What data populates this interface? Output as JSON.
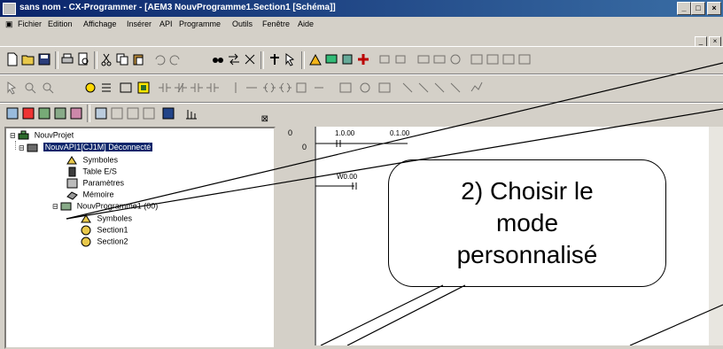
{
  "window": {
    "title": "sans nom - CX-Programmer - [AEM3 NouvProgramme1.Section1 [Schéma]]",
    "controls": [
      "_",
      "□",
      "×"
    ]
  },
  "menu": {
    "items": [
      "Fichier",
      "Edition",
      "Affichage",
      "Insérer",
      "API",
      "Programme",
      "Outils",
      "Fenêtre",
      "Aide"
    ],
    "mdi_controls": [
      "_",
      "×"
    ]
  },
  "tree": {
    "root": "NouvProjet",
    "plc": "NouvAPI1[CJ1M] Déconnecté",
    "children": [
      "Symboles",
      "Table E/S",
      "Paramètres",
      "Mémoire"
    ],
    "program": "NouvProgramme1 (00)",
    "program_children": [
      "Symboles",
      "Section1",
      "Section2"
    ]
  },
  "ladder": {
    "rung_number": "0",
    "step_number": "0",
    "contacts": [
      {
        "address": "1.0.00"
      },
      {
        "address": "0.1.00"
      },
      {
        "address": "W0.00"
      }
    ]
  },
  "callout": {
    "line1": "2) Choisir le",
    "line2": "mode",
    "line3": "personnalisé"
  },
  "colors": {
    "title_bar": "#0a246a",
    "selected": "#0a246a",
    "chrome": "#d4d0c8",
    "tree_icon": "#2d6a2d"
  }
}
